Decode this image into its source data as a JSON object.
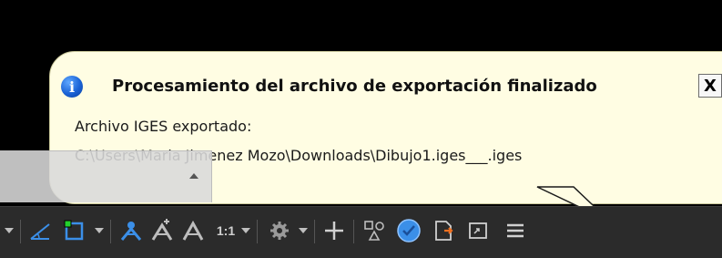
{
  "notification": {
    "title": "Procesamiento del archivo de exportación finalizado",
    "close_label": "X",
    "message_line1": "Archivo IGES exportado:",
    "message_line2": "C:\\Users\\Maria Jimenez Mozo\\Downloads\\Dibujo1.iges___.iges",
    "info_icon": "i"
  },
  "statusbar": {
    "scale_label": "1:1",
    "icons": [
      "caret-down-icon",
      "polar-tracking-icon",
      "object-snap-icon",
      "caret-down-icon",
      "annotation-visibility-icon",
      "auto-scale-icon",
      "annotation-scale-icon",
      "scale-1-1",
      "caret-down-icon",
      "gear-icon",
      "caret-down-icon",
      "plus-icon",
      "isolate-objects-icon",
      "hardware-accel-icon",
      "export-notification-icon",
      "fullscreen-icon",
      "hamburger-menu-icon"
    ]
  },
  "colors": {
    "tooltip_bg": "#fffde3",
    "statusbar_bg": "#2b2b2b",
    "accent_blue": "#3b8fe8"
  }
}
